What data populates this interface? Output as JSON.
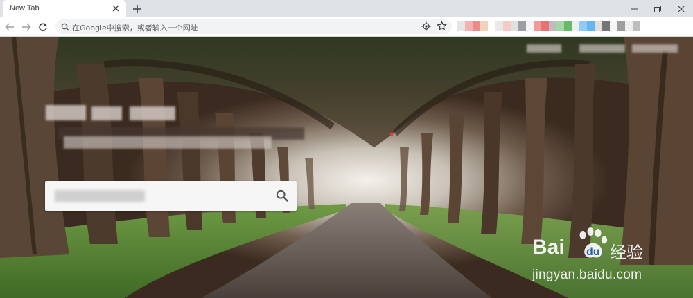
{
  "tab": {
    "title": "New Tab"
  },
  "omnibox": {
    "placeholder": "在Google中搜索，或者输入一个网址"
  },
  "watermark": {
    "site": "jingyan.baidu.com",
    "brand": "Baidu经验"
  },
  "icons": {
    "tab_close": "close-icon",
    "new_tab": "plus-icon",
    "minimize": "minimize-icon",
    "restore": "restore-icon",
    "close_window": "close-icon",
    "back": "arrow-left-icon",
    "forward": "arrow-right-icon",
    "reload": "reload-icon",
    "search": "search-icon",
    "location": "location-icon",
    "bookmark": "star-icon"
  },
  "colors": {
    "tabstrip": "#dee1e6",
    "toolbar": "#ffffff",
    "omnibox": "#f1f3f4",
    "accent_red": "#e53935"
  },
  "extensions": [
    "#e6e6e6",
    "#f3b1b1",
    "#e98b8b",
    "#f2d2b8",
    "#ffffff",
    "#e9e9e9",
    "#f7c9c9",
    "#e0e0e0",
    "#9aa0a6",
    "#f5f5f5",
    "#ef9a9a",
    "#e57373",
    "#bdbdbd",
    "#a5d6a7",
    "#66bb6a",
    "#eeeeee",
    "#90caf9",
    "#64b5f6",
    "#e0e0e0",
    "#757575",
    "#f5f5f5",
    "#9e9e9e",
    "#eeeeee",
    "#bdbdbd"
  ]
}
